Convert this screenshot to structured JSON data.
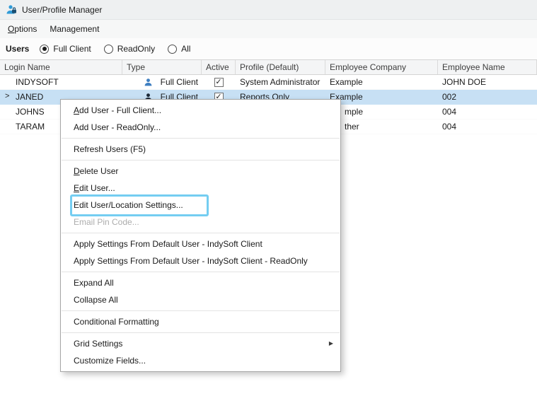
{
  "window": {
    "title": "User/Profile Manager"
  },
  "menubar": {
    "items": [
      {
        "label": "Options",
        "ul": 0
      },
      {
        "label": "Management"
      }
    ]
  },
  "filter": {
    "label": "Users",
    "options": [
      {
        "label": "Full Client",
        "selected": true
      },
      {
        "label": "ReadOnly",
        "selected": false
      },
      {
        "label": "All",
        "selected": false
      }
    ]
  },
  "grid": {
    "columns": [
      {
        "label": "Login Name"
      },
      {
        "label": "Type"
      },
      {
        "label": "Active"
      },
      {
        "label": "Profile (Default)"
      },
      {
        "label": "Employee Company"
      },
      {
        "label": "Employee Name"
      }
    ],
    "selected_row_marker": ">",
    "rows": [
      {
        "login": "INDYSOFT",
        "type": "Full Client",
        "icon": "user-icon",
        "icon_color": "#3f7fc1",
        "active": true,
        "profile": "System Administrator",
        "company": "Example",
        "employee": "JOHN DOE",
        "selected": false,
        "covered": false
      },
      {
        "login": "JANED",
        "type": "Full Client",
        "icon": "user-icon",
        "icon_color": "#1b2735",
        "active": true,
        "profile": "Reports Only",
        "company": "Example",
        "employee": "002",
        "selected": true,
        "covered": false
      },
      {
        "login": "JOHNS",
        "company_fragment": "mple",
        "employee": "004",
        "selected": false,
        "covered": true
      },
      {
        "login": "TARAM",
        "company_fragment": "ther",
        "employee": "004",
        "selected": false,
        "covered": true
      }
    ]
  },
  "context_menu": {
    "items": [
      {
        "type": "item",
        "label": "Add User - Full Client...",
        "ul": 0
      },
      {
        "type": "item",
        "label": "Add User - ReadOnly..."
      },
      {
        "type": "separator"
      },
      {
        "type": "item",
        "label": "Refresh Users (F5)"
      },
      {
        "type": "separator"
      },
      {
        "type": "item",
        "label": "Delete User",
        "ul": 0
      },
      {
        "type": "item",
        "label": "Edit User...",
        "ul": 0
      },
      {
        "type": "item",
        "label": "Edit User/Location Settings...",
        "highlighted": true
      },
      {
        "type": "item",
        "label": "Email Pin Code...",
        "disabled": true
      },
      {
        "type": "separator"
      },
      {
        "type": "item",
        "label": "Apply Settings From Default User - IndySoft Client"
      },
      {
        "type": "item",
        "label": "Apply Settings From Default User - IndySoft Client - ReadOnly"
      },
      {
        "type": "separator"
      },
      {
        "type": "item",
        "label": "Expand All"
      },
      {
        "type": "item",
        "label": "Collapse All"
      },
      {
        "type": "separator"
      },
      {
        "type": "item",
        "label": "Conditional Formatting"
      },
      {
        "type": "separator"
      },
      {
        "type": "item",
        "label": "Grid Settings",
        "submenu": true
      },
      {
        "type": "item",
        "label": "Customize Fields..."
      }
    ],
    "submenu_arrow": "▶"
  },
  "colors": {
    "selection": "#c7e0f4",
    "highlight_annotation": "#74cdf1",
    "disabled_text": "#adadad",
    "check_glyph": "✓"
  }
}
